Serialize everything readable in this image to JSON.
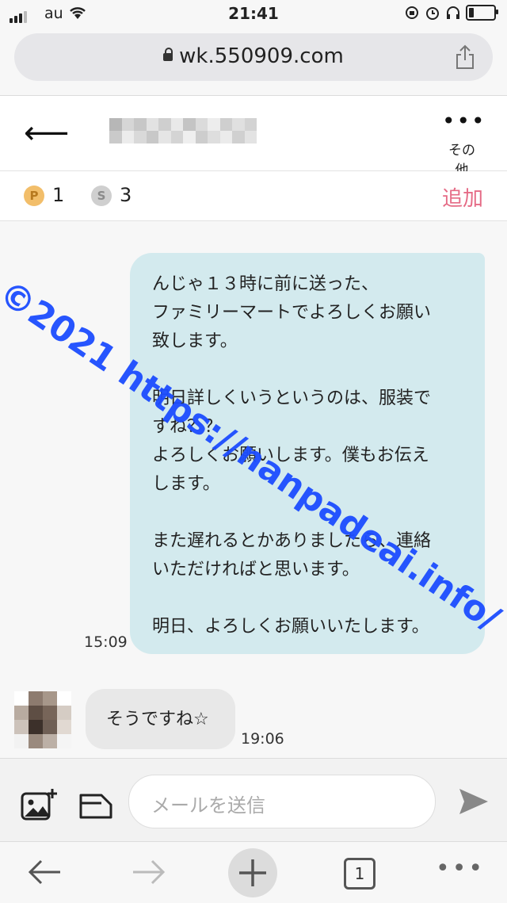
{
  "status_bar": {
    "carrier": "au",
    "time": "21:41"
  },
  "browser": {
    "url": "wk.550909.com"
  },
  "header": {
    "more_label": "その他"
  },
  "points": {
    "p_icon": "P",
    "p_count": "1",
    "s_icon": "S",
    "s_count": "3",
    "add_label": "追加"
  },
  "messages": [
    {
      "direction": "sent",
      "lines": [
        "んじゃ１３時に前に送った、",
        "ファミリーマートでよろしくお願い",
        "致します。",
        "",
        "明日詳しくいうというのは、服装で",
        "すね？？",
        "よろしくお願いします。僕もお伝え",
        "します。",
        "",
        "また遅れるとかありましたら、連絡",
        "いただければと思います。",
        "",
        "明日、よろしくお願いいたします。"
      ],
      "time": "15:09"
    },
    {
      "direction": "received",
      "text": "そうですね☆",
      "time": "19:06"
    }
  ],
  "watermark": "©2021 https://nanpadeai.info/",
  "compose": {
    "placeholder": "メールを送信"
  },
  "toolbar": {
    "tab_count": "1"
  },
  "colors": {
    "accent": "#e56b86",
    "bubble_out": "#d3eaee",
    "bubble_in": "#e8e8e8",
    "watermark": "#1c4dff"
  }
}
